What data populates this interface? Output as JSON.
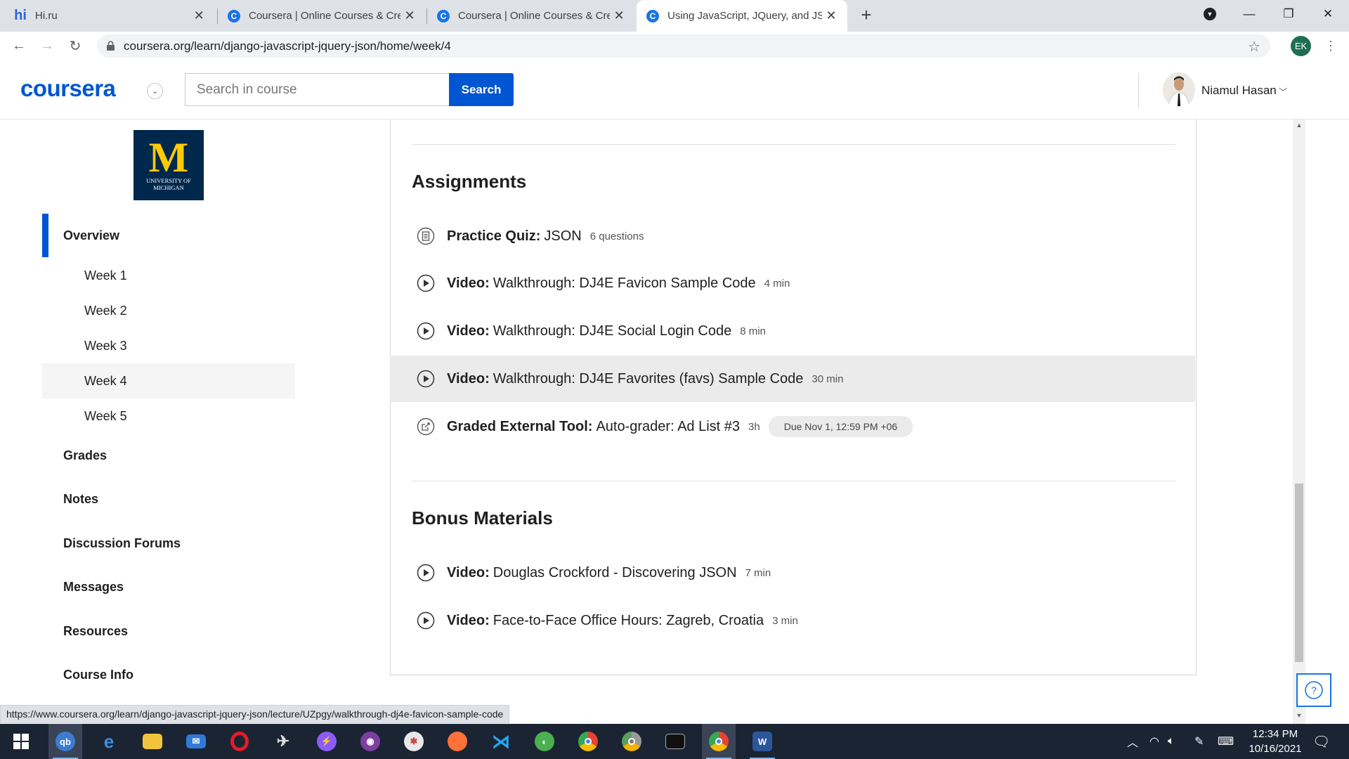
{
  "browser": {
    "tabs": [
      {
        "title": "Hi.ru",
        "icon": "hi-favicon"
      },
      {
        "title": "Coursera | Online Courses & Crec",
        "icon": "coursera-favicon"
      },
      {
        "title": "Coursera | Online Courses & Crec",
        "icon": "coursera-favicon"
      },
      {
        "title": "Using JavaScript, JQuery, and JSC",
        "icon": "coursera-favicon",
        "active": true
      }
    ],
    "url": "coursera.org/learn/django-javascript-jquery-json/home/week/4",
    "profile_initials": "EK",
    "status_url": "https://www.coursera.org/learn/django-javascript-jquery-json/lecture/UZpgy/walkthrough-dj4e-favicon-sample-code"
  },
  "header": {
    "logo": "coursera",
    "search_placeholder": "Search in course",
    "search_button": "Search",
    "user_name": "Niamul Hasan"
  },
  "sidebar": {
    "university_logo": {
      "letter": "M",
      "text": "UNIVERSITY OF MICHIGAN"
    },
    "overview": "Overview",
    "weeks": [
      "Week 1",
      "Week 2",
      "Week 3",
      "Week 4",
      "Week 5"
    ],
    "selected_week": "Week 4",
    "links": [
      "Grades",
      "Notes",
      "Discussion Forums",
      "Messages",
      "Resources",
      "Course Info"
    ]
  },
  "main": {
    "assignments": {
      "title": "Assignments",
      "items": [
        {
          "icon": "quiz-icon",
          "type": "Practice Quiz:",
          "title": "JSON",
          "meta": "6 questions"
        },
        {
          "icon": "play-icon",
          "type": "Video:",
          "title": "Walkthrough: DJ4E Favicon Sample Code",
          "meta": "4 min"
        },
        {
          "icon": "play-icon",
          "type": "Video:",
          "title": "Walkthrough: DJ4E Social Login Code",
          "meta": "8 min"
        },
        {
          "icon": "play-icon",
          "type": "Video:",
          "title": "Walkthrough: DJ4E Favorites (favs) Sample Code",
          "meta": "30 min",
          "highlighted": true
        },
        {
          "icon": "external-tool-icon",
          "type": "Graded External Tool:",
          "title": "Auto-grader: Ad List #3",
          "meta": "3h",
          "due": "Due Nov 1, 12:59 PM +06"
        }
      ]
    },
    "bonus": {
      "title": "Bonus Materials",
      "items": [
        {
          "icon": "play-icon",
          "type": "Video:",
          "title": "Douglas Crockford - Discovering JSON",
          "meta": "7 min"
        },
        {
          "icon": "play-icon",
          "type": "Video:",
          "title": "Face-to-Face Office Hours: Zagreb, Croatia",
          "meta": "3 min"
        }
      ]
    }
  },
  "taskbar": {
    "apps": [
      "start",
      "qbittorrent",
      "edge",
      "file-explorer",
      "mail",
      "opera",
      "satellite-app",
      "messenger",
      "github-desktop",
      "pinwheel-app",
      "firefox",
      "vscode",
      "browser-app",
      "chrome",
      "chrome-dev",
      "terminal",
      "chrome-profile-ek",
      "word"
    ],
    "clock_time": "12:34 PM",
    "clock_date": "10/16/2021"
  },
  "colors": {
    "brand": "#0056d2",
    "highlight_row": "#ebebeb",
    "umich_blue": "#00274c",
    "umich_maize": "#ffcb05"
  }
}
